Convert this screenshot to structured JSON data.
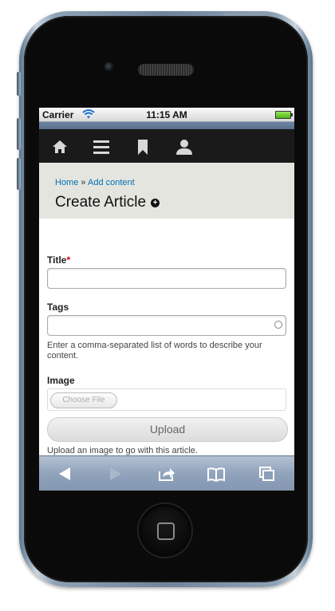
{
  "status_bar": {
    "carrier": "Carrier",
    "time": "11:15 AM"
  },
  "nav": {
    "icons": [
      "home-icon",
      "menu-icon",
      "bookmark-icon",
      "user-icon"
    ]
  },
  "breadcrumb": {
    "home": "Home",
    "separator": "»",
    "current": "Add content"
  },
  "page": {
    "title": "Create Article"
  },
  "form": {
    "title_label": "Title",
    "title_required_marker": "*",
    "title_value": "",
    "tags_label": "Tags",
    "tags_value": "",
    "tags_description": "Enter a comma-separated list of words to describe your content.",
    "image_label": "Image",
    "choose_file_label": "Choose File",
    "upload_label": "Upload",
    "image_description": "Upload an image to go with this article."
  },
  "browser_toolbar": {
    "icons": [
      "back-icon",
      "forward-icon",
      "share-icon",
      "bookmarks-icon",
      "pages-icon"
    ]
  },
  "colors": {
    "link": "#0071b3",
    "nav_background": "#1a1a1a",
    "header_background": "#e5e5df",
    "required": "#cc0000"
  }
}
